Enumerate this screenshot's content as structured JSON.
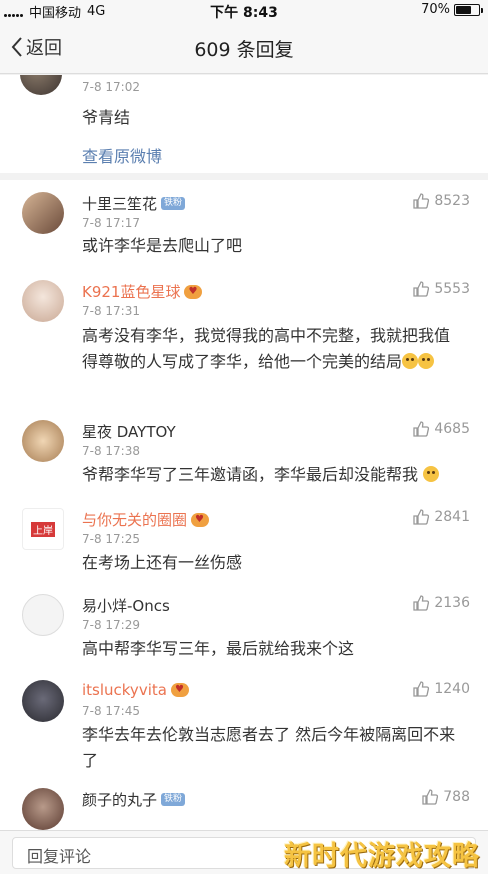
{
  "status_bar": {
    "carrier": "中国移动",
    "network": "4G",
    "time": "下午 8:43",
    "battery_text": "70%",
    "battery_level": 0.7
  },
  "nav": {
    "back_label": "返回",
    "title": "609 条回复"
  },
  "top_comment": {
    "time": "7-8 17:02",
    "text": "爷青结",
    "link": "查看原微博"
  },
  "comments": [
    {
      "name": "十里三笙花",
      "name_color": "#333333",
      "badge": "铁粉",
      "vip": false,
      "time": "7-8 17:17",
      "text": "或许李华是去爬山了吧",
      "likes": "8523",
      "avatar_color": "#c9a98a"
    },
    {
      "name": "K921蓝色星球",
      "name_color": "#eb7350",
      "badge": "",
      "vip": true,
      "time": "7-8 17:31",
      "text": "高考没有李华，我觉得我的高中不完整，我就把我值得尊敬的人写成了李华，给他一个完美的结局",
      "likes": "5553",
      "avatar_color": "#e8d6c8"
    },
    {
      "name": "星夜 DAYTOY",
      "name_color": "#333333",
      "badge": "",
      "vip": false,
      "time": "7-8 17:38",
      "text": "爷帮李华写了三年邀请函，李华最后却没能帮我",
      "likes": "4685",
      "avatar_color": "#d9b08a"
    },
    {
      "name": "与你无关的圈圈",
      "name_color": "#eb7350",
      "badge": "",
      "vip": true,
      "time": "7-8 17:25",
      "text": "在考场上还有一丝伤感",
      "likes": "2841",
      "avatar_color": "#d63a3a",
      "avatar_text": "上岸"
    },
    {
      "name": "易小烊-Oncs",
      "name_color": "#333333",
      "badge": "",
      "vip": false,
      "time": "7-8 17:29",
      "text": "高中帮李华写三年，最后就给我来个这",
      "likes": "2136",
      "avatar_color": "#eeeeee"
    },
    {
      "name": "itsluckyvita",
      "name_color": "#eb7350",
      "badge": "",
      "vip": true,
      "time": "7-8 17:45",
      "text": "李华去年去伦敦当志愿者去了 然后今年被隔离回不来了",
      "likes": "1240",
      "avatar_color": "#4a4a55"
    },
    {
      "name": "颜子的丸子",
      "name_color": "#333333",
      "badge": "铁粉",
      "vip": false,
      "time": "",
      "text": "",
      "likes": "788",
      "avatar_color": "#8a6a5a"
    }
  ],
  "bottom": {
    "reply_placeholder": "回复评论",
    "watermark": "新时代游戏攻略"
  }
}
